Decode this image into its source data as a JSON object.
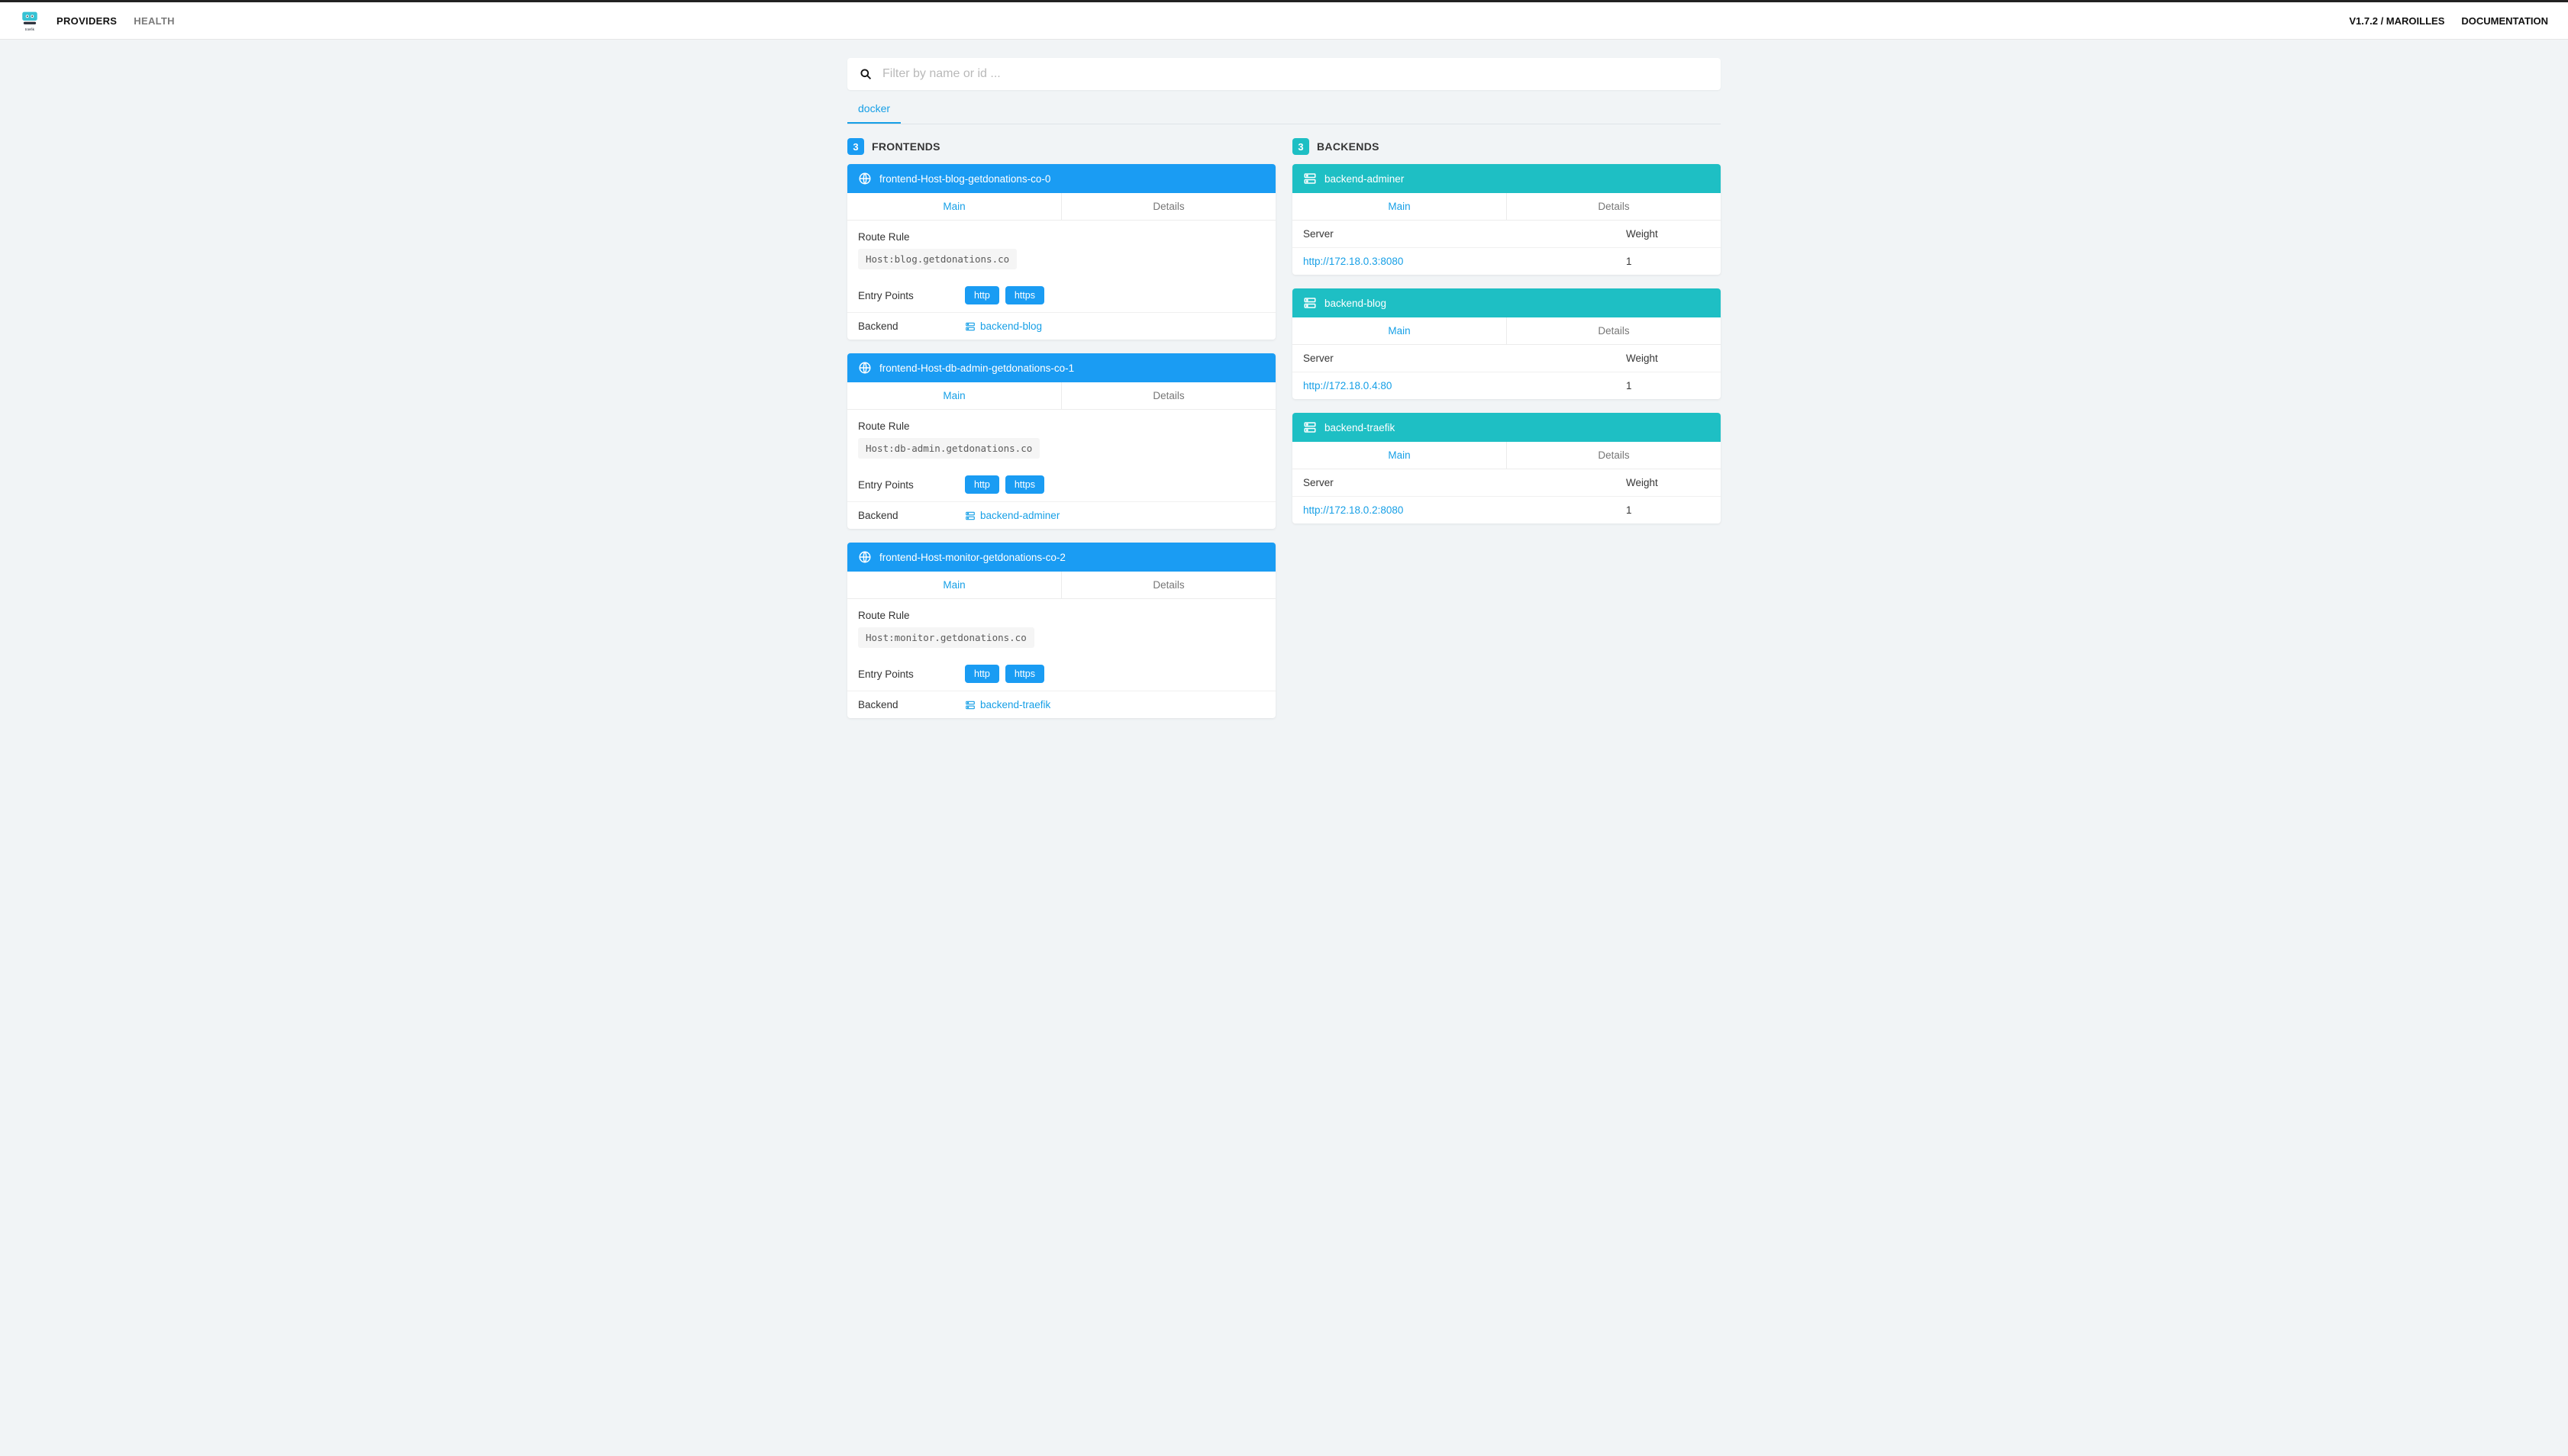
{
  "header": {
    "nav": {
      "providers": "PROVIDERS",
      "health": "HEALTH"
    },
    "version": "V1.7.2 / MAROILLES",
    "documentation": "DOCUMENTATION"
  },
  "search": {
    "placeholder": "Filter by name or id ..."
  },
  "provider_tab": "docker",
  "frontends": {
    "title": "FRONTENDS",
    "count": "3",
    "labels": {
      "main": "Main",
      "details": "Details",
      "route_rule": "Route Rule",
      "entry_points": "Entry Points",
      "backend": "Backend"
    },
    "items": [
      {
        "name": "frontend-Host-blog-getdonations-co-0",
        "rule": "Host:blog.getdonations.co",
        "entry_points": [
          "http",
          "https"
        ],
        "backend": "backend-blog"
      },
      {
        "name": "frontend-Host-db-admin-getdonations-co-1",
        "rule": "Host:db-admin.getdonations.co",
        "entry_points": [
          "http",
          "https"
        ],
        "backend": "backend-adminer"
      },
      {
        "name": "frontend-Host-monitor-getdonations-co-2",
        "rule": "Host:monitor.getdonations.co",
        "entry_points": [
          "http",
          "https"
        ],
        "backend": "backend-traefik"
      }
    ]
  },
  "backends": {
    "title": "BACKENDS",
    "count": "3",
    "labels": {
      "main": "Main",
      "details": "Details",
      "server": "Server",
      "weight": "Weight"
    },
    "items": [
      {
        "name": "backend-adminer",
        "server": "http://172.18.0.3:8080",
        "weight": "1"
      },
      {
        "name": "backend-blog",
        "server": "http://172.18.0.4:80",
        "weight": "1"
      },
      {
        "name": "backend-traefik",
        "server": "http://172.18.0.2:8080",
        "weight": "1"
      }
    ]
  }
}
